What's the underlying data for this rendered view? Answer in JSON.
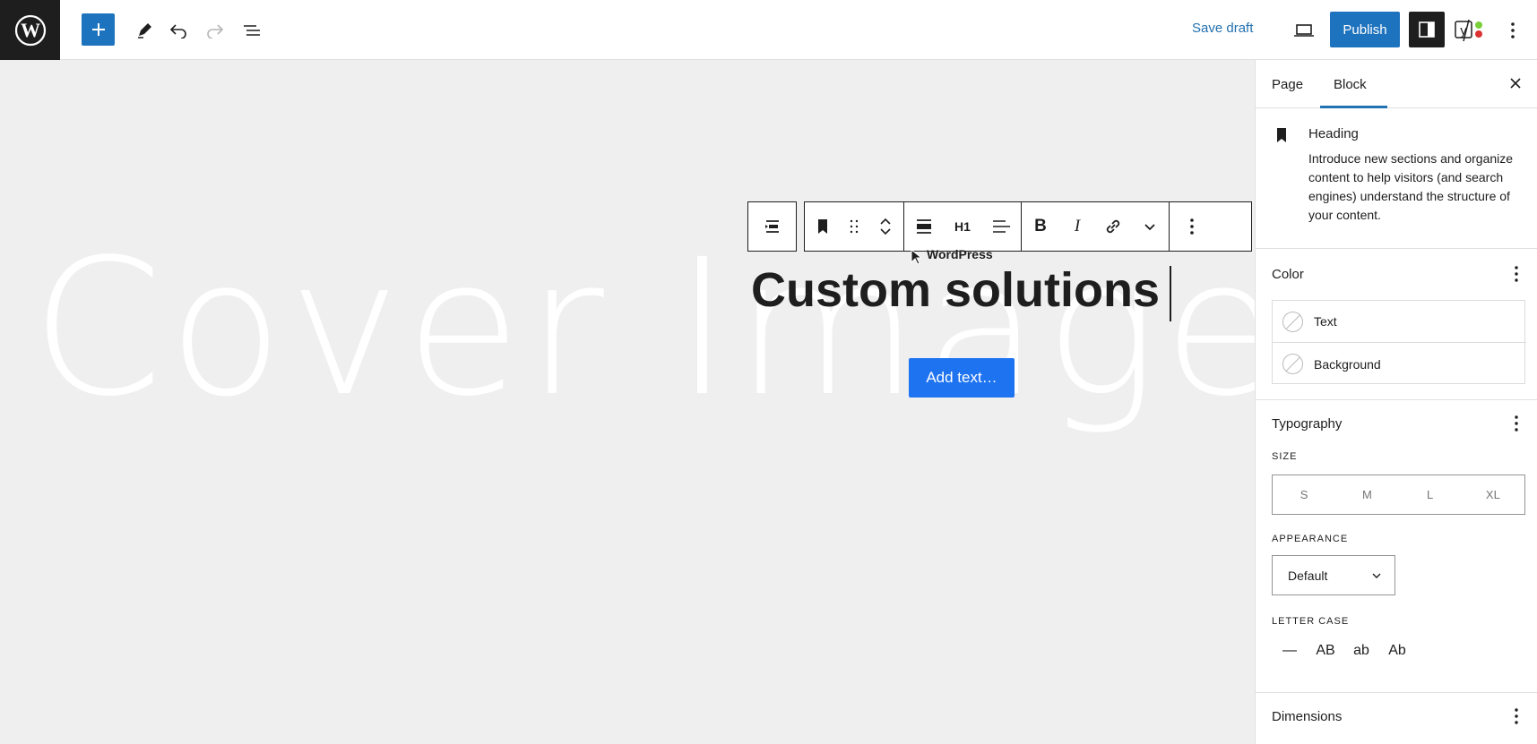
{
  "topbar": {
    "save_draft": "Save draft",
    "publish": "Publish"
  },
  "canvas": {
    "cover_placeholder": "Cover Image",
    "block_label": "WordPress",
    "heading_text": "Custom solutions",
    "add_text_button": "Add text…",
    "heading_level": "H1"
  },
  "sidebar": {
    "tabs": [
      {
        "label": "Page",
        "active": false
      },
      {
        "label": "Block",
        "active": true
      }
    ],
    "block": {
      "title": "Heading",
      "description": "Introduce new sections and organize content to help visitors (and search engines) understand the structure of your content."
    },
    "color": {
      "title": "Color",
      "items": [
        {
          "label": "Text"
        },
        {
          "label": "Background"
        }
      ]
    },
    "typography": {
      "title": "Typography",
      "size_label": "SIZE",
      "sizes": [
        "S",
        "M",
        "L",
        "XL"
      ],
      "appearance_label": "APPEARANCE",
      "appearance_value": "Default",
      "letter_case_label": "LETTER CASE",
      "letter_cases": [
        "—",
        "AB",
        "ab",
        "Ab"
      ]
    },
    "dimensions": {
      "title": "Dimensions"
    }
  },
  "colors": {
    "accent": "#1e73be",
    "canvas_bg": "#efefef",
    "dark": "#1e1e1e"
  }
}
